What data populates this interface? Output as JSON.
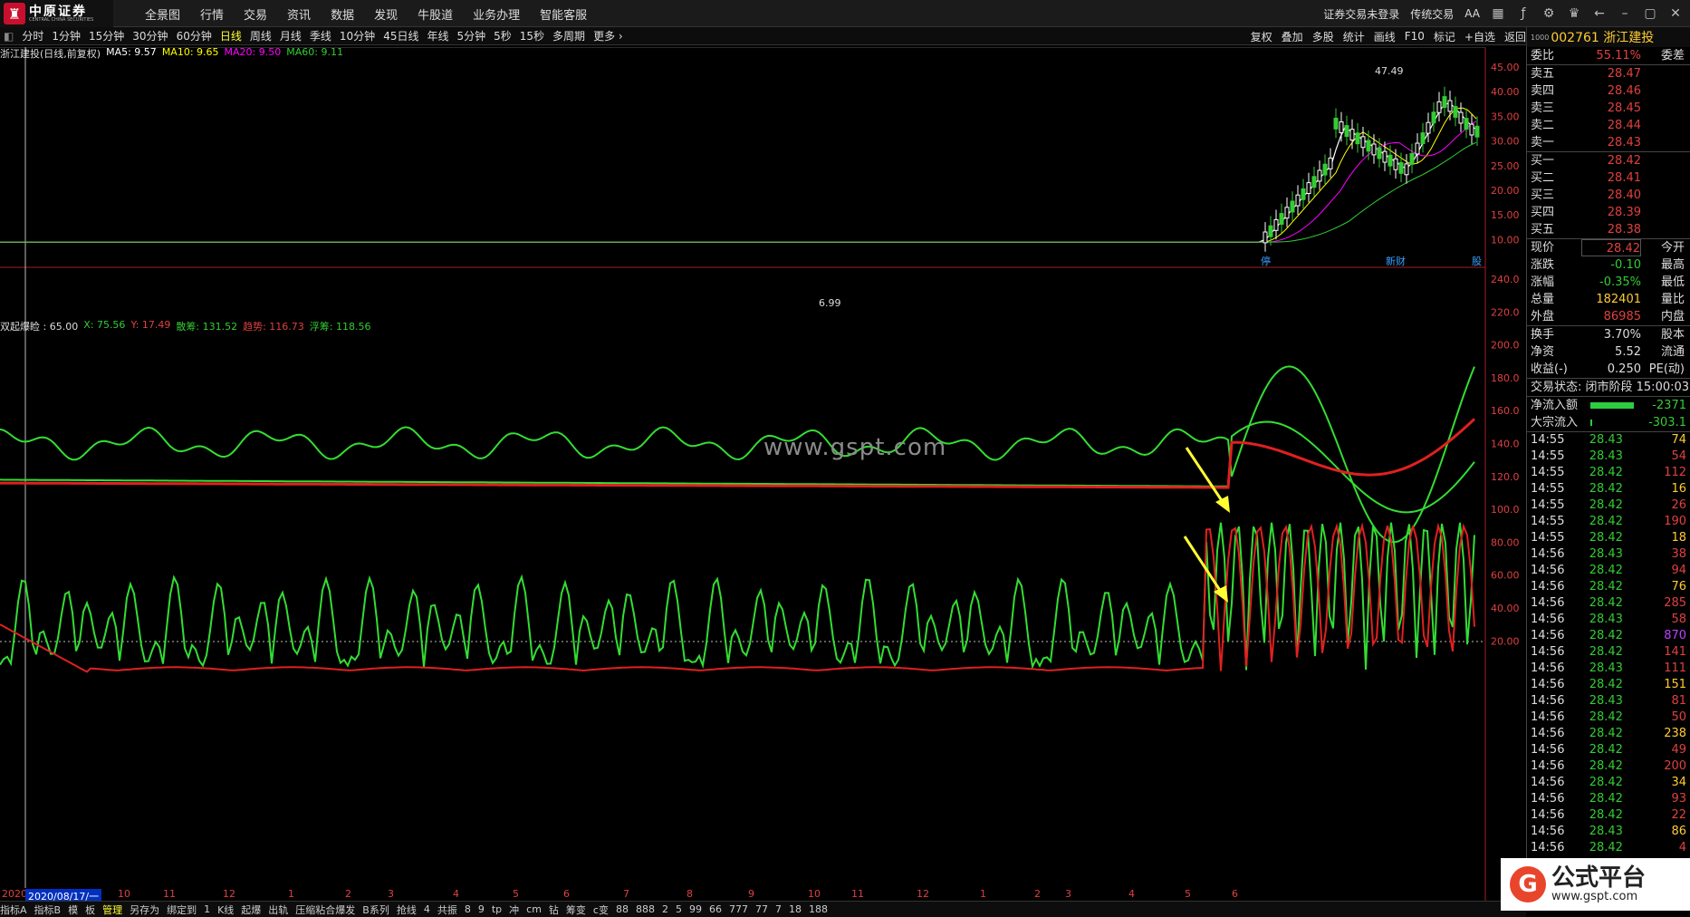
{
  "app": {
    "logo_cn": "中原证券",
    "logo_en": "CENTRAL CHINA SECURITIES"
  },
  "menu": [
    "全景图",
    "行情",
    "交易",
    "资讯",
    "数据",
    "发现",
    "牛股道",
    "业务办理",
    "智能客服"
  ],
  "right_menu": {
    "login": "证券交易未登录",
    "trade": "传统交易",
    "font": "AA"
  },
  "periods": [
    "分时",
    "1分钟",
    "15分钟",
    "30分钟",
    "60分钟",
    "日线",
    "周线",
    "月线",
    "季线",
    "10分钟",
    "45日线",
    "年线",
    "5分钟",
    "5秒",
    "15秒",
    "多周期",
    "更多 ›"
  ],
  "active_period": "日线",
  "tools": [
    "复权",
    "叠加",
    "多股",
    "统计",
    "画线",
    "F10",
    "标记",
    "+自选",
    "返回"
  ],
  "stock": {
    "prefix": "1000",
    "code_name": "002761 浙江建投"
  },
  "main_legend": {
    "name": "浙江建投(日线,前复权)",
    "ma5": "MA5: 9.57",
    "ma10": "MA10: 9.65",
    "ma20": "MA20: 9.50",
    "ma60": "MA60: 9.11"
  },
  "main_y_labels": [
    "45.00",
    "40.00",
    "35.00",
    "30.00",
    "25.00",
    "20.00",
    "15.00",
    "10.00"
  ],
  "price_marks": {
    "high": "47.49",
    "low": "6.99"
  },
  "indicator_legend": {
    "name": "双起爆睑 : 65.00",
    "x": "X: 75.56",
    "y": "Y: 17.49",
    "sansou": "散筹: 131.52",
    "trend": "趋势: 116.73",
    "float": "浮筹: 118.56"
  },
  "ind_y_labels": [
    "240.0",
    "220.0",
    "200.0",
    "180.0",
    "160.0",
    "140.0",
    "120.0",
    "100.0",
    "80.00",
    "60.00",
    "40.00",
    "20.00"
  ],
  "x_labels": [
    "2020",
    "10",
    "11",
    "12",
    "1",
    "2",
    "3",
    "4",
    "5",
    "6",
    "7",
    "8",
    "9",
    "10",
    "11",
    "12",
    "1",
    "2",
    "3",
    "4",
    "5",
    "6"
  ],
  "date_box": "2020/08/17/一",
  "event_tags": [
    "停",
    "新财",
    "股"
  ],
  "order_book": {
    "weibi": {
      "label": "委比",
      "value": "55.11%",
      "right": "委差"
    },
    "sells": [
      {
        "label": "卖五",
        "price": "28.47"
      },
      {
        "label": "卖四",
        "price": "28.46"
      },
      {
        "label": "卖三",
        "price": "28.45"
      },
      {
        "label": "卖二",
        "price": "28.44"
      },
      {
        "label": "卖一",
        "price": "28.43"
      }
    ],
    "buys": [
      {
        "label": "买一",
        "price": "28.42"
      },
      {
        "label": "买二",
        "price": "28.41"
      },
      {
        "label": "买三",
        "price": "28.40"
      },
      {
        "label": "买四",
        "price": "28.39"
      },
      {
        "label": "买五",
        "price": "28.38"
      }
    ]
  },
  "quote": [
    {
      "label": "现价",
      "value": "28.42",
      "right": "今开"
    },
    {
      "label": "涨跌",
      "value": "-0.10",
      "right": "最高"
    },
    {
      "label": "涨幅",
      "value": "-0.35%",
      "right": "最低"
    },
    {
      "label": "总量",
      "value": "182401",
      "right": "量比"
    },
    {
      "label": "外盘",
      "value": "86985",
      "right": "内盘"
    },
    {
      "label": "换手",
      "value": "3.70%",
      "right": "股本"
    },
    {
      "label": "净资",
      "value": "5.52",
      "right": "流通"
    },
    {
      "label": "收益(-)",
      "value": "0.250",
      "right": "PE(动)"
    }
  ],
  "status": "交易状态: 闭市阶段 15:00:03",
  "flows": [
    {
      "label": "净流入额",
      "value": "-2371",
      "bar": 0.85
    },
    {
      "label": "大宗流入",
      "value": "-303.1",
      "bar": 0.04
    }
  ],
  "ticks": [
    [
      "14:55",
      "28.43",
      "74"
    ],
    [
      "14:55",
      "28.43",
      "54"
    ],
    [
      "14:55",
      "28.42",
      "112"
    ],
    [
      "14:55",
      "28.42",
      "16"
    ],
    [
      "14:55",
      "28.42",
      "26"
    ],
    [
      "14:55",
      "28.42",
      "190"
    ],
    [
      "14:55",
      "28.42",
      "18"
    ],
    [
      "14:56",
      "28.43",
      "38"
    ],
    [
      "14:56",
      "28.42",
      "94"
    ],
    [
      "14:56",
      "28.42",
      "76"
    ],
    [
      "14:56",
      "28.42",
      "285"
    ],
    [
      "14:56",
      "28.43",
      "58"
    ],
    [
      "14:56",
      "28.42",
      "870"
    ],
    [
      "14:56",
      "28.42",
      "141"
    ],
    [
      "14:56",
      "28.43",
      "111"
    ],
    [
      "14:56",
      "28.42",
      "151"
    ],
    [
      "14:56",
      "28.43",
      "81"
    ],
    [
      "14:56",
      "28.42",
      "50"
    ],
    [
      "14:56",
      "28.42",
      "238"
    ],
    [
      "14:56",
      "28.42",
      "49"
    ],
    [
      "14:56",
      "28.42",
      "200"
    ],
    [
      "14:56",
      "28.42",
      "34"
    ],
    [
      "14:56",
      "28.42",
      "93"
    ],
    [
      "14:56",
      "28.42",
      "22"
    ],
    [
      "14:56",
      "28.43",
      "86"
    ],
    [
      "14:56",
      "28.42",
      "4"
    ]
  ],
  "bottom_tabs": [
    "指标A",
    "指标B",
    "模",
    "板",
    "管理",
    "另存为",
    "绑定到",
    "1",
    "K线",
    "起爆",
    "出轨",
    "压缩粘合爆发",
    "B系列",
    "抢线",
    "4",
    "共振",
    "8",
    "9",
    "tp",
    "冲",
    "cm",
    "钻",
    "筹变",
    "c变",
    "88",
    "888",
    "2",
    "5",
    "99",
    "66",
    "777",
    "77",
    "7",
    "18",
    "188"
  ],
  "active_bottom": "管理",
  "watermark": "www.gspt.com",
  "brand": {
    "name": "公式平台",
    "url": "www.gspt.com"
  },
  "colors": {
    "up": "#e04040",
    "down": "#33cc33",
    "ma5": "#ffffff",
    "ma10": "#ffff00",
    "ma20": "#ff00ff",
    "ma60": "#33cc33",
    "accent": "#ffcc33"
  }
}
